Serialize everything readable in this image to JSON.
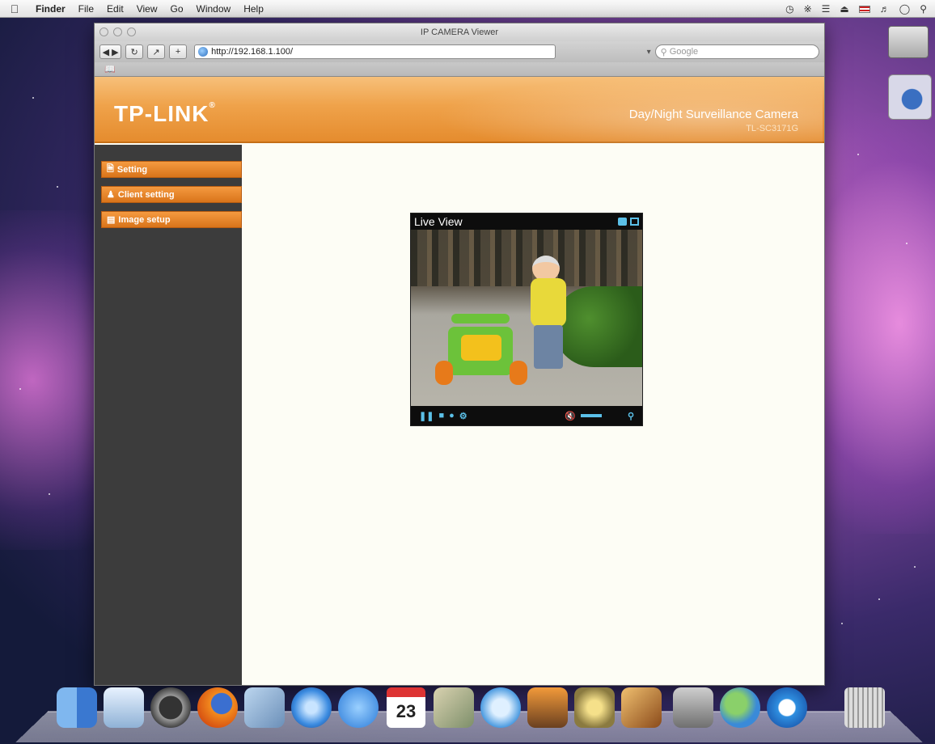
{
  "menubar": {
    "items": [
      "Finder",
      "File",
      "Edit",
      "View",
      "Go",
      "Window",
      "Help"
    ]
  },
  "browser": {
    "title": "IP CAMERA Viewer",
    "url": "http://192.168.1.100/",
    "search_placeholder": "Google",
    "url_dropdown": "▾"
  },
  "banner": {
    "logo": "TP-LINK",
    "product_title": "Day/Night Surveillance Camera",
    "product_model": "TL-SC3171G"
  },
  "sidebar": {
    "items": [
      {
        "label": "Setting",
        "icon": "document-icon"
      },
      {
        "label": "Client setting",
        "icon": "users-icon"
      },
      {
        "label": "Image setup",
        "icon": "image-setup-icon"
      }
    ]
  },
  "live_view": {
    "title": "Live View"
  },
  "dock": {
    "calendar_day": "23"
  },
  "colors": {
    "accent": "#e58c2e",
    "sidebar_bg": "#3c3c3c",
    "control_blue": "#5bc0e8"
  }
}
